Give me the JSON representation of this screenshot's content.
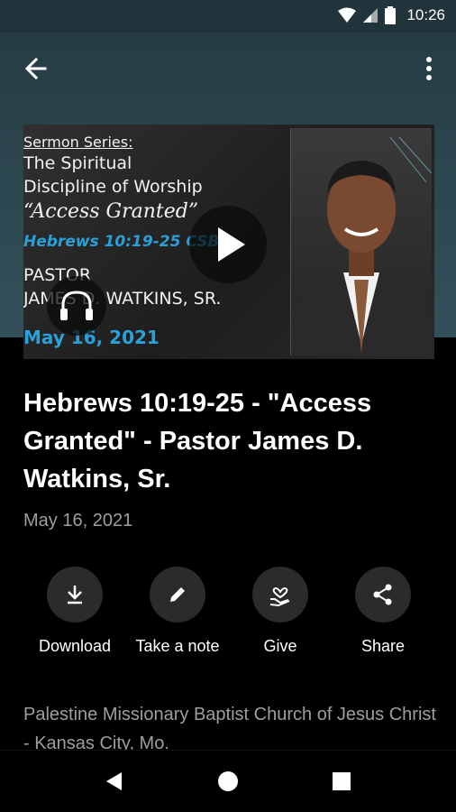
{
  "status_bar": {
    "time": "10:26"
  },
  "hero": {
    "series_label": "Sermon Series:",
    "series_line1": "The Spiritual",
    "series_line2": "Discipline of Worship",
    "subtitle": "“Access Granted”",
    "verse": "Hebrews 10:19-25 CSB",
    "pastor_label": "PASTOR",
    "pastor_name": "JAMES D. WATKINS, SR.",
    "date": "May 16, 2021"
  },
  "sermon": {
    "title": "Hebrews 10:19-25 - \"Access Granted\" - Pastor James D. Watkins, Sr.",
    "date": "May 16, 2021"
  },
  "actions": [
    {
      "label": "Download",
      "icon": "download-icon"
    },
    {
      "label": "Take a note",
      "icon": "pencil-icon"
    },
    {
      "label": "Give",
      "icon": "give-icon"
    },
    {
      "label": "Share",
      "icon": "share-icon"
    }
  ],
  "organization": "Palestine Missionary Baptist Church of Jesus Christ - Kansas City, Mo.",
  "colors": {
    "header_bg": "#2e4952",
    "accent_blue": "#2aa0d8",
    "secondary_text": "#9e9e9e",
    "action_circle": "#2b2b2b"
  }
}
